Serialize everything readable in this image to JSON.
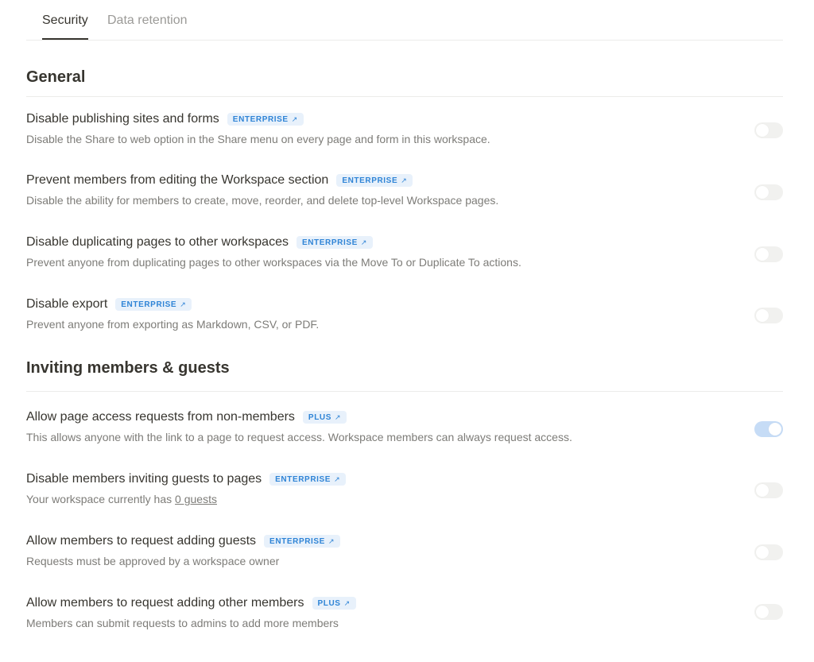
{
  "tabs": [
    {
      "label": "Security",
      "active": true
    },
    {
      "label": "Data retention",
      "active": false
    }
  ],
  "sections": [
    {
      "title": "General",
      "settings": [
        {
          "title": "Disable publishing sites and forms",
          "badge": "ENTERPRISE",
          "badge_icon": "external-arrow-icon",
          "description": "Disable the Share to web option in the Share menu on every page and form in this workspace.",
          "enabled": false
        },
        {
          "title": "Prevent members from editing the Workspace section",
          "badge": "ENTERPRISE",
          "badge_icon": "external-arrow-icon",
          "description": "Disable the ability for members to create, move, reorder, and delete top-level Workspace pages.",
          "enabled": false
        },
        {
          "title": "Disable duplicating pages to other workspaces",
          "badge": "ENTERPRISE",
          "badge_icon": "external-arrow-icon",
          "description": "Prevent anyone from duplicating pages to other workspaces via the Move To or Duplicate To actions.",
          "enabled": false
        },
        {
          "title": "Disable export",
          "badge": "ENTERPRISE",
          "badge_icon": "external-arrow-icon",
          "description": "Prevent anyone from exporting as Markdown, CSV, or PDF.",
          "enabled": false
        }
      ]
    },
    {
      "title": "Inviting members & guests",
      "settings": [
        {
          "title": "Allow page access requests from non-members",
          "badge": "PLUS",
          "badge_icon": "external-arrow-icon",
          "description": "This allows anyone with the link to a page to request access. Workspace members can always request access.",
          "enabled": true
        },
        {
          "title": "Disable members inviting guests to pages",
          "badge": "ENTERPRISE",
          "badge_icon": "external-arrow-icon",
          "description_prefix": "Your workspace currently has ",
          "description_link": "0 guests",
          "enabled": false
        },
        {
          "title": "Allow members to request adding guests",
          "badge": "ENTERPRISE",
          "badge_icon": "external-arrow-icon",
          "description": "Requests must be approved by a workspace owner",
          "enabled": false
        },
        {
          "title": "Allow members to request adding other members",
          "badge": "PLUS",
          "badge_icon": "external-arrow-icon",
          "description": "Members can submit requests to admins to add more members",
          "enabled": false
        }
      ]
    }
  ],
  "colors": {
    "badge_bg": "#e8f1fb",
    "badge_text": "#2f84d6",
    "toggle_on": "#c6dcf6",
    "toggle_off": "#f1f1ef"
  }
}
